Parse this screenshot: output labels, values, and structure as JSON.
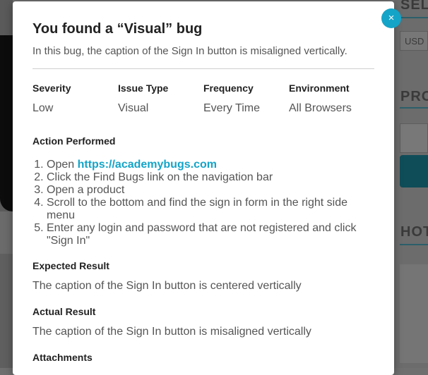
{
  "background": {
    "right_titles": [
      "SEL",
      "PRO",
      "HOT"
    ],
    "currency": "USD"
  },
  "modal": {
    "close_icon": "×",
    "title": "You found a “Visual” bug",
    "subtitle": "In this bug, the caption of the Sign In button is misaligned vertically.",
    "meta": [
      {
        "label": "Severity",
        "value": "Low"
      },
      {
        "label": "Issue Type",
        "value": "Visual"
      },
      {
        "label": "Frequency",
        "value": "Every Time"
      },
      {
        "label": "Environment",
        "value": "All Browsers"
      }
    ],
    "action_heading": "Action Performed",
    "steps": {
      "step1_prefix": "Open ",
      "step1_link": "https://academybugs.com",
      "step2": "Click the Find Bugs link on the navigation bar",
      "step3": "Open a product",
      "step4": "Scroll to the bottom and find the sign in form in the right side menu",
      "step5": "Enter any login and password that are not registered and click \"Sign In\""
    },
    "expected_heading": "Expected Result",
    "expected_text": "The caption of the Sign In button is centered vertically",
    "actual_heading": "Actual Result",
    "actual_text": "The caption of the Sign In button is misaligned vertically",
    "attachments_heading": "Attachments"
  }
}
